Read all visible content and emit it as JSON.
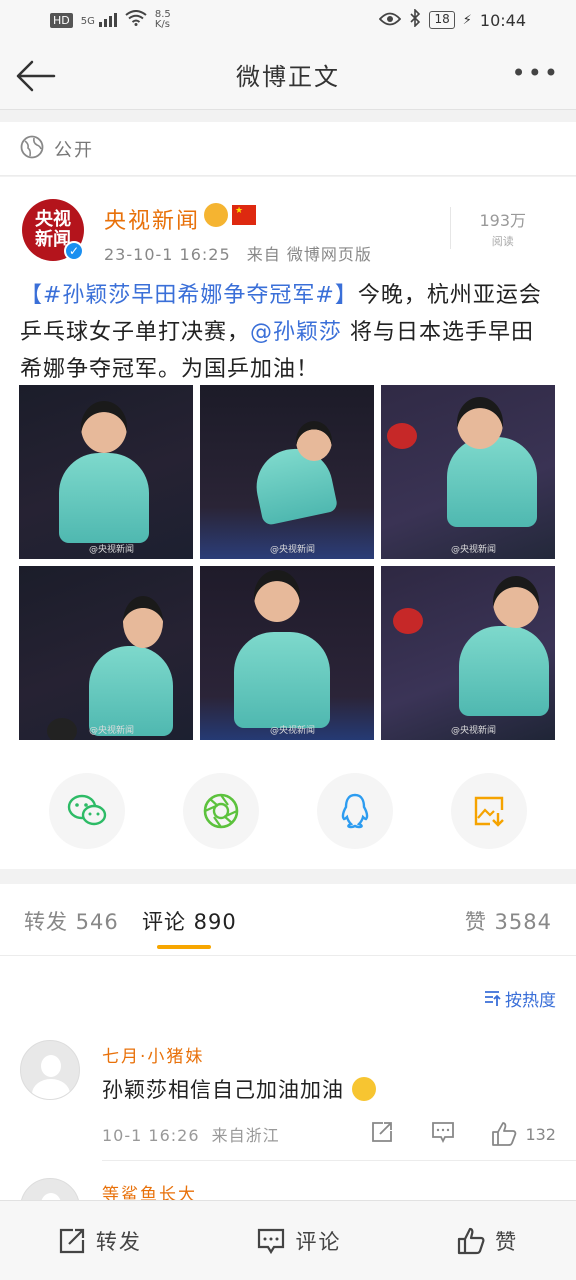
{
  "status_bar": {
    "network": "HD",
    "signal_label": "5G",
    "speed_value": "8.5",
    "speed_unit": "K/s",
    "battery": "18",
    "time": "10:44"
  },
  "nav": {
    "title": "微博正文"
  },
  "visibility": {
    "label": "公开"
  },
  "post": {
    "author": "央视新闻",
    "avatar_text_top": "央视",
    "avatar_text_bottom": "新闻",
    "time": "23-10-1 16:25",
    "source": "来自 微博网页版",
    "reads_count": "193万",
    "reads_label": "阅读",
    "hashtag": "【#孙颖莎早田希娜争夺冠军#】",
    "text_before_mention": "今晚，杭州亚运会乒乓球女子单打决赛，",
    "mention": "@孙颖莎",
    "text_after_mention": " 将与日本选手早田希娜争夺冠军。为国乒加油！",
    "photo_watermark": "@央视新闻"
  },
  "share": [
    {
      "icon": "wechat-icon"
    },
    {
      "icon": "moments-icon"
    },
    {
      "icon": "qq-icon"
    },
    {
      "icon": "save-image-icon"
    }
  ],
  "tabs": {
    "repost": "转发 546",
    "comment": "评论 890",
    "like": "赞 3584"
  },
  "sort_label": "按热度",
  "comments": [
    {
      "name": "七月·小猪妹",
      "text": "孙颖莎相信自己加油加油",
      "time": "10-1 16:26",
      "location": "来自浙江",
      "likes": "132"
    },
    {
      "name": "等鲨鱼长大"
    }
  ],
  "bottom_bar": {
    "repost": "转发",
    "comment": "评论",
    "like": "赞"
  },
  "colors": {
    "accent": "#f7a600",
    "author": "#e8710a",
    "link": "#3a6fd8",
    "brand_red": "#b4141c"
  }
}
